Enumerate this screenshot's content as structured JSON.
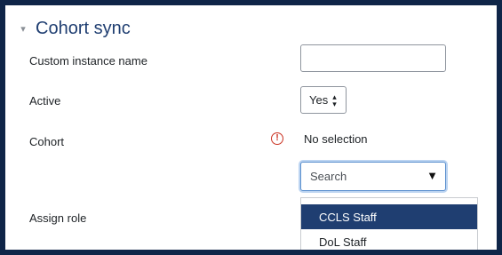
{
  "section": {
    "title": "Cohort sync",
    "collapse_icon": "▾"
  },
  "fields": {
    "instance_name_label": "Custom instance name",
    "instance_name_value": "",
    "active_label": "Active",
    "active_value": "Yes",
    "cohort_label": "Cohort",
    "cohort_selection": "No selection",
    "required_icon": "!",
    "search_placeholder": "Search",
    "search_caret": "▼",
    "assign_role_label": "Assign role"
  },
  "cohort_options": [
    {
      "label": "CCLS Staff",
      "selected": true
    },
    {
      "label": "DoL Staff",
      "selected": false
    }
  ],
  "colors": {
    "frame_border": "#0f2548",
    "heading": "#1f3e71",
    "selected_bg": "#1f3e71",
    "required": "#ca3120"
  }
}
